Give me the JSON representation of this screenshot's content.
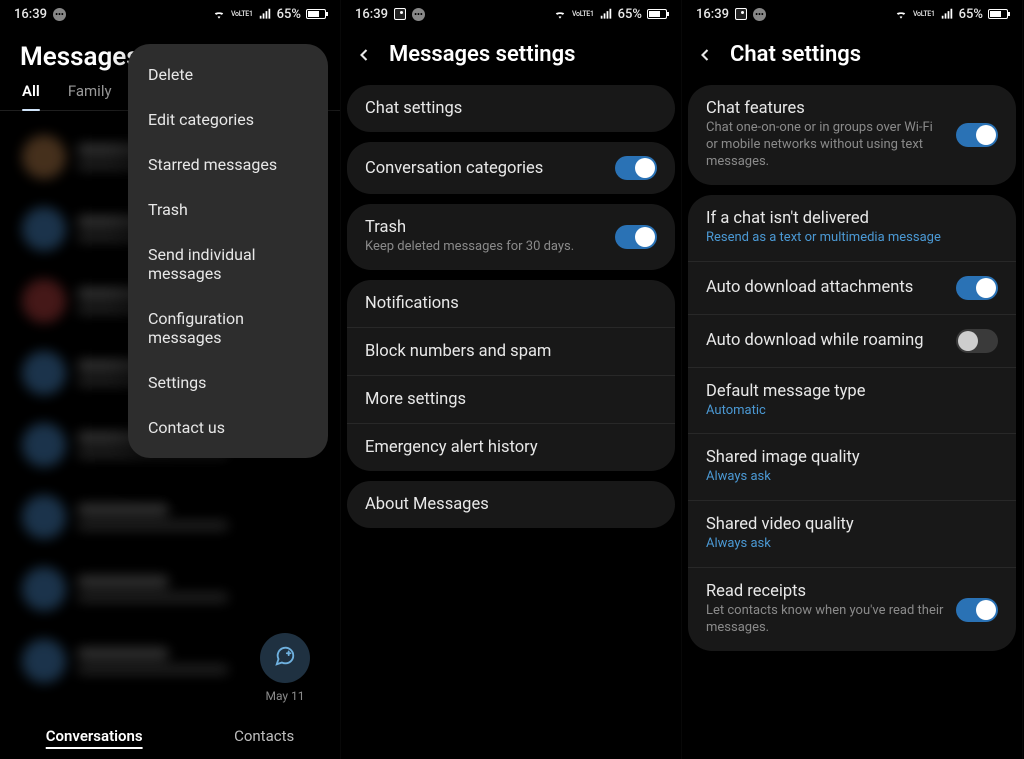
{
  "status": {
    "time": "16:39",
    "volte": "VoLTE1",
    "battery_percent": "65%"
  },
  "phone1": {
    "title": "Messages",
    "tabs": [
      "All",
      "Family"
    ],
    "active_tab_index": 0,
    "menu": [
      "Delete",
      "Edit categories",
      "Starred messages",
      "Trash",
      "Send individual messages",
      "Configuration messages",
      "Settings",
      "Contact us"
    ],
    "fab_date": "May 11",
    "bottom_tabs": [
      "Conversations",
      "Contacts"
    ],
    "active_bottom_index": 0
  },
  "phone2": {
    "header": "Messages settings",
    "groups": [
      {
        "items": [
          {
            "title": "Chat settings"
          }
        ]
      },
      {
        "items": [
          {
            "title": "Conversation categories",
            "toggle": true
          }
        ]
      },
      {
        "items": [
          {
            "title": "Trash",
            "sub": "Keep deleted messages for 30 days.",
            "toggle": true
          }
        ]
      },
      {
        "items": [
          {
            "title": "Notifications"
          },
          {
            "title": "Block numbers and spam"
          },
          {
            "title": "More settings"
          },
          {
            "title": "Emergency alert history"
          }
        ]
      },
      {
        "items": [
          {
            "title": "About Messages"
          }
        ]
      }
    ]
  },
  "phone3": {
    "header": "Chat settings",
    "groups": [
      {
        "items": [
          {
            "title": "Chat features",
            "sub": "Chat one-on-one or in groups over Wi-Fi or mobile networks without using text messages.",
            "toggle": true
          }
        ]
      },
      {
        "items": [
          {
            "title": "If a chat isn't delivered",
            "sub": "Resend as a text or multimedia message",
            "sub_link": true
          },
          {
            "title": "Auto download attachments",
            "toggle": true
          },
          {
            "title": "Auto download while roaming",
            "toggle": false
          },
          {
            "title": "Default message type",
            "sub": "Automatic",
            "sub_link": true
          },
          {
            "title": "Shared image quality",
            "sub": "Always ask",
            "sub_link": true
          },
          {
            "title": "Shared video quality",
            "sub": "Always ask",
            "sub_link": true
          },
          {
            "title": "Read receipts",
            "sub": "Let contacts know when you've read their messages.",
            "toggle": true
          }
        ]
      }
    ]
  }
}
